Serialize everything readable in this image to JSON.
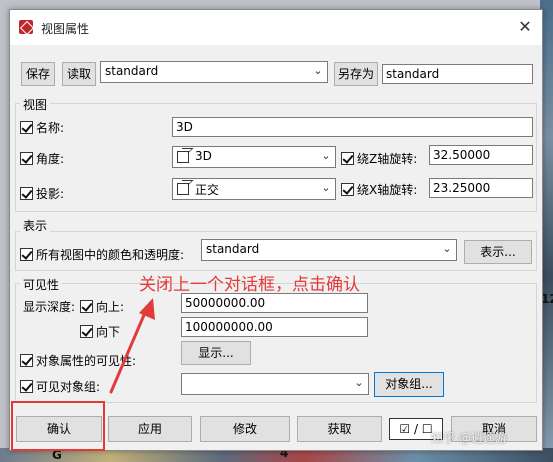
{
  "window": {
    "title": "视图属性",
    "close_glyph": "✕"
  },
  "toolbar": {
    "save_label": "保存",
    "load_label": "读取",
    "preset_value": "standard",
    "save_as_label": "另存为",
    "save_as_value": "standard"
  },
  "view_group": {
    "title": "视图",
    "name_label": "名称:",
    "name_value": "3D",
    "angle_label": "角度:",
    "angle_value": "3D",
    "rotate_z_label": "绕Z轴旋转:",
    "rotate_z_value": "32.50000",
    "projection_label": "投影:",
    "projection_value": "正交",
    "rotate_x_label": "绕X轴旋转:",
    "rotate_x_value": "23.25000"
  },
  "display_group": {
    "title": "表示",
    "color_label": "所有视图中的颜色和透明度:",
    "color_value": "standard",
    "display_button": "表示..."
  },
  "visibility_group": {
    "title": "可见性",
    "depth_label": "显示深度:",
    "up_label": "向上:",
    "up_value": "50000000.00",
    "down_label": "向下",
    "down_value": "100000000.00",
    "object_props_label": "对象属性的可见性:",
    "show_button": "显示...",
    "visible_group_label": "可见对象组:",
    "visible_group_value": "",
    "object_group_button": "对象组..."
  },
  "footer": {
    "ok_label": "确认",
    "apply_label": "应用",
    "modify_label": "修改",
    "get_label": "获取",
    "toggle_label": "☑ / ☐",
    "cancel_label": "取消"
  },
  "annotation": {
    "text": "关闭上一个对话框，点击确认",
    "color": "#e33a3a"
  },
  "watermark": {
    "text": "知乎 @逍遥游"
  },
  "background_labels": {
    "g": "G",
    "four": "4",
    "twelve": "12"
  }
}
